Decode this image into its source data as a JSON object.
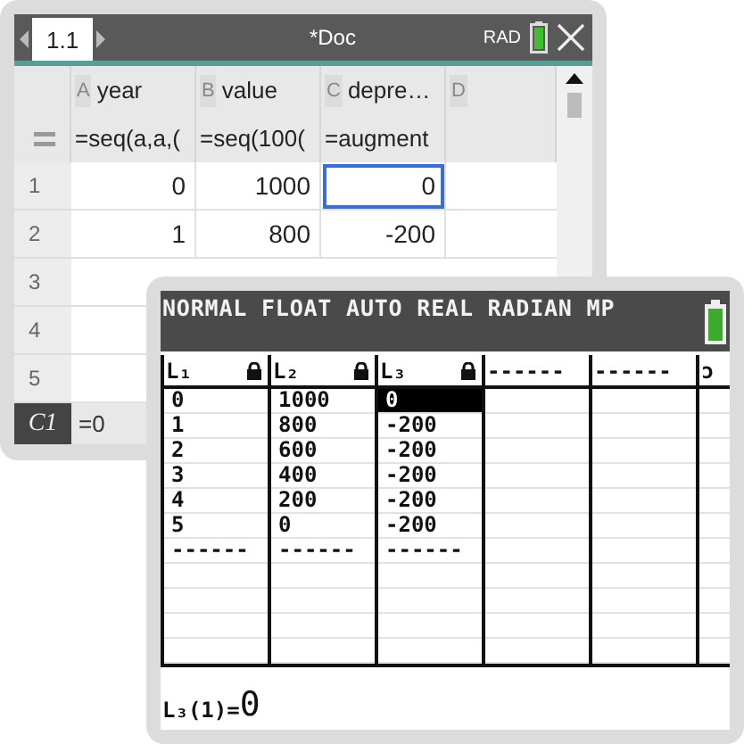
{
  "nspire": {
    "tab": {
      "label": "1.1",
      "selected": true
    },
    "title": "*Doc",
    "mode": "RAD",
    "columns": [
      {
        "letter": "A",
        "name": "year"
      },
      {
        "letter": "B",
        "name": "value"
      },
      {
        "letter": "C",
        "name": "depre…"
      },
      {
        "letter": "D"
      }
    ],
    "formulas": [
      "=seq(a,a,(",
      "=seq(100(",
      "=augment"
    ],
    "rows": [
      {
        "number": "1",
        "cells": [
          {
            "text": "0",
            "selected": false
          },
          {
            "text": "1000",
            "selected": false
          },
          {
            "text": "0",
            "selected": true
          }
        ]
      },
      {
        "number": "2",
        "cells": [
          {
            "text": "1",
            "selected": false
          },
          {
            "text": "800",
            "selected": false
          },
          {
            "text": "-200",
            "selected": false
          }
        ]
      },
      {
        "number": "3",
        "cells": []
      },
      {
        "number": "4",
        "cells": []
      },
      {
        "number": "5",
        "cells": []
      }
    ],
    "status": {
      "cell": "C1",
      "value": "=0"
    }
  },
  "ti84": {
    "status_text": "NORMAL FLOAT AUTO REAL RADIAN MP",
    "lists": [
      {
        "name": "L₁",
        "locked": true,
        "values": [
          {
            "text": "0",
            "selected": false
          },
          {
            "text": "1",
            "selected": false
          },
          {
            "text": "2",
            "selected": false
          },
          {
            "text": "3",
            "selected": false
          },
          {
            "text": "4",
            "selected": false
          },
          {
            "text": "5",
            "selected": false
          },
          {
            "text": "------",
            "selected": false
          }
        ]
      },
      {
        "name": "L₂",
        "locked": true,
        "values": [
          {
            "text": "1000",
            "selected": false
          },
          {
            "text": "800",
            "selected": false
          },
          {
            "text": "600",
            "selected": false
          },
          {
            "text": "400",
            "selected": false
          },
          {
            "text": "200",
            "selected": false
          },
          {
            "text": "0",
            "selected": false
          },
          {
            "text": "------",
            "selected": false
          }
        ]
      },
      {
        "name": "L₃",
        "locked": true,
        "values": [
          {
            "text": "0",
            "selected": true
          },
          {
            "text": "-200",
            "selected": false
          },
          {
            "text": "-200",
            "selected": false
          },
          {
            "text": "-200",
            "selected": false
          },
          {
            "text": "-200",
            "selected": false
          },
          {
            "text": "-200",
            "selected": false
          },
          {
            "text": "------",
            "selected": false
          }
        ]
      },
      {
        "name": "------",
        "locked": false
      },
      {
        "name": "------",
        "locked": false
      },
      {
        "name": "ɔ",
        "locked": false
      }
    ],
    "entry": {
      "label": "L₃(1)=",
      "value": "0"
    }
  }
}
